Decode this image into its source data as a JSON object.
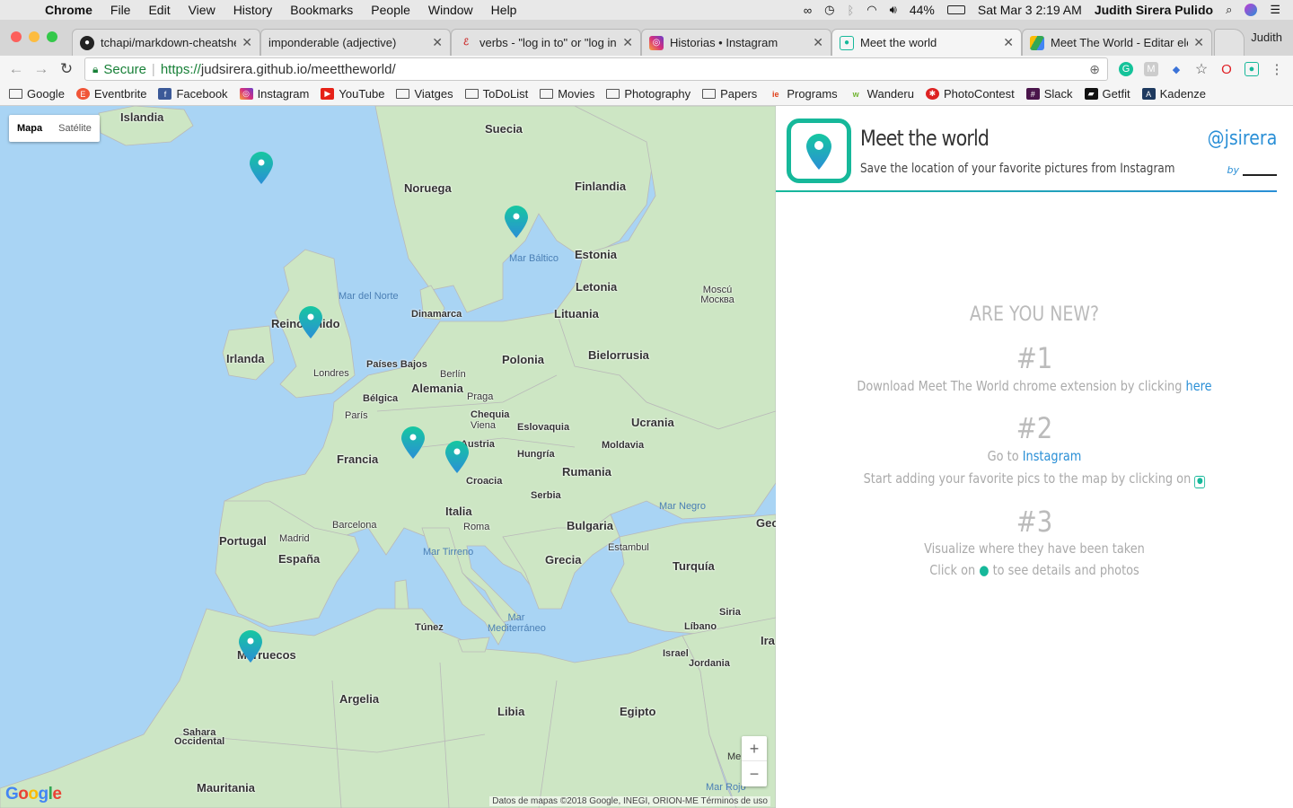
{
  "menubar": {
    "app": "Chrome",
    "items": [
      "File",
      "Edit",
      "View",
      "History",
      "Bookmarks",
      "People",
      "Window",
      "Help"
    ],
    "battery": "44%",
    "datetime": "Sat Mar 3  2:19 AM",
    "user": "Judith Sirera Pulido"
  },
  "tabs": [
    {
      "title": "tchapi/markdown-cheatsheet",
      "icon": "github-icon"
    },
    {
      "title": "imponderable (adjective)",
      "icon": "none"
    },
    {
      "title": "verbs - \"log in to\" or \"log in\"",
      "icon": "stackexchange-icon"
    },
    {
      "title": "Historias • Instagram",
      "icon": "instagram-icon"
    },
    {
      "title": "Meet the world",
      "icon": "meettheworld-icon",
      "active": true
    },
    {
      "title": "Meet The World - Editar ele",
      "icon": "drive-icon"
    }
  ],
  "profile_name": "Judith",
  "omnibox": {
    "secure_label": "Secure",
    "url_proto": "https://",
    "url_rest": "judsirera.github.io/meettheworld/"
  },
  "bookmarks": [
    {
      "label": "Google",
      "icon": "folder"
    },
    {
      "label": "Eventbrite",
      "icon": "eventbrite"
    },
    {
      "label": "Facebook",
      "icon": "facebook"
    },
    {
      "label": "Instagram",
      "icon": "instagram"
    },
    {
      "label": "YouTube",
      "icon": "youtube"
    },
    {
      "label": "Viatges",
      "icon": "folder"
    },
    {
      "label": "ToDoList",
      "icon": "folder"
    },
    {
      "label": "Movies",
      "icon": "folder"
    },
    {
      "label": "Photography",
      "icon": "folder"
    },
    {
      "label": "Papers",
      "icon": "folder"
    },
    {
      "label": "Programs",
      "icon": "programs"
    },
    {
      "label": "Wanderu",
      "icon": "wanderu"
    },
    {
      "label": "PhotoContest",
      "icon": "photocontest"
    },
    {
      "label": "Slack",
      "icon": "slack"
    },
    {
      "label": "Getfit",
      "icon": "getfit"
    },
    {
      "label": "Kadenze",
      "icon": "kadenze"
    }
  ],
  "map": {
    "type_buttons": [
      "Mapa",
      "Satélite"
    ],
    "countries": [
      "Islandia",
      "Suecia",
      "Noruega",
      "Finlandia",
      "Estonia",
      "Letonia",
      "Lituania",
      "Dinamarca",
      "Reino Unido",
      "Irlanda",
      "Países Bajos",
      "Alemania",
      "Polonia",
      "Bielorrusia",
      "Bélgica",
      "Chequia",
      "Eslovaquia",
      "Ucrania",
      "Moldavia",
      "Austria",
      "Hungría",
      "Francia",
      "Rumania",
      "Croacia",
      "Serbia",
      "Italia",
      "Bulgaria",
      "Portugal",
      "España",
      "Grecia",
      "Turquía",
      "Marruecos",
      "Túnez",
      "Argelia",
      "Libia",
      "Egipto",
      "Siria",
      "Líbano",
      "Israel",
      "Jordania",
      "Mauritania",
      "Sahara Occidental",
      "Geo",
      "Ira"
    ],
    "cities": [
      "Moscú Москва",
      "Londres",
      "Berlín",
      "Praga",
      "Viena",
      "París",
      "Roma",
      "Madrid",
      "Barcelona",
      "Estambul"
    ],
    "seas": [
      "Mar del Norte",
      "Mar Báltico",
      "Mar Negro",
      "Mar Tirreno",
      "Mar Mediterráneo",
      "Mar Rojo",
      "Me"
    ],
    "zoom_in": "+",
    "zoom_out": "−",
    "brand": "Google",
    "attribution": "Datos de mapas ©2018 Google, INEGI, ORION-ME    Términos de uso"
  },
  "panel": {
    "title": "Meet the world",
    "subtitle": "Save the location of your favorite pictures from Instagram",
    "handle": "@jsirera",
    "by": "by",
    "question": "ARE YOU NEW?",
    "step1": {
      "num": "#1",
      "text": "Download Meet The World chrome extension by clicking ",
      "link": "here"
    },
    "step2": {
      "num": "#2",
      "text": "Go to ",
      "link": "Instagram",
      "line2": "Start adding your favorite pics to the map by clicking on"
    },
    "step3": {
      "num": "#3",
      "line1": "Visualize where they have been taken",
      "line2a": "Click on",
      "line2b": "to see details and photos"
    }
  },
  "colors": {
    "accent": "#16b89a",
    "link": "#2a8fd6",
    "water": "#a9d4f4",
    "land": "#cde6c4"
  }
}
